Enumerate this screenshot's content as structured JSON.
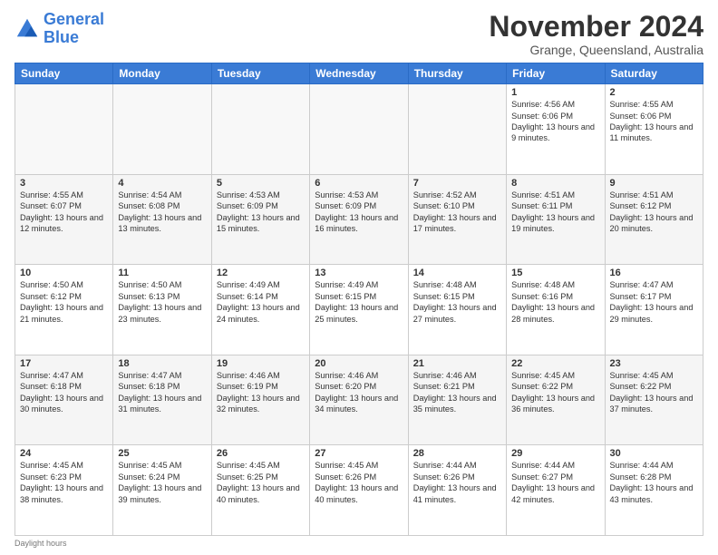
{
  "logo": {
    "line1": "General",
    "line2": "Blue"
  },
  "title": "November 2024",
  "subtitle": "Grange, Queensland, Australia",
  "days_of_week": [
    "Sunday",
    "Monday",
    "Tuesday",
    "Wednesday",
    "Thursday",
    "Friday",
    "Saturday"
  ],
  "footer": "Daylight hours",
  "weeks": [
    [
      {
        "day": "",
        "sunrise": "",
        "sunset": "",
        "daylight": ""
      },
      {
        "day": "",
        "sunrise": "",
        "sunset": "",
        "daylight": ""
      },
      {
        "day": "",
        "sunrise": "",
        "sunset": "",
        "daylight": ""
      },
      {
        "day": "",
        "sunrise": "",
        "sunset": "",
        "daylight": ""
      },
      {
        "day": "",
        "sunrise": "",
        "sunset": "",
        "daylight": ""
      },
      {
        "day": "1",
        "sunrise": "Sunrise: 4:56 AM",
        "sunset": "Sunset: 6:06 PM",
        "daylight": "Daylight: 13 hours and 9 minutes."
      },
      {
        "day": "2",
        "sunrise": "Sunrise: 4:55 AM",
        "sunset": "Sunset: 6:06 PM",
        "daylight": "Daylight: 13 hours and 11 minutes."
      }
    ],
    [
      {
        "day": "3",
        "sunrise": "Sunrise: 4:55 AM",
        "sunset": "Sunset: 6:07 PM",
        "daylight": "Daylight: 13 hours and 12 minutes."
      },
      {
        "day": "4",
        "sunrise": "Sunrise: 4:54 AM",
        "sunset": "Sunset: 6:08 PM",
        "daylight": "Daylight: 13 hours and 13 minutes."
      },
      {
        "day": "5",
        "sunrise": "Sunrise: 4:53 AM",
        "sunset": "Sunset: 6:09 PM",
        "daylight": "Daylight: 13 hours and 15 minutes."
      },
      {
        "day": "6",
        "sunrise": "Sunrise: 4:53 AM",
        "sunset": "Sunset: 6:09 PM",
        "daylight": "Daylight: 13 hours and 16 minutes."
      },
      {
        "day": "7",
        "sunrise": "Sunrise: 4:52 AM",
        "sunset": "Sunset: 6:10 PM",
        "daylight": "Daylight: 13 hours and 17 minutes."
      },
      {
        "day": "8",
        "sunrise": "Sunrise: 4:51 AM",
        "sunset": "Sunset: 6:11 PM",
        "daylight": "Daylight: 13 hours and 19 minutes."
      },
      {
        "day": "9",
        "sunrise": "Sunrise: 4:51 AM",
        "sunset": "Sunset: 6:12 PM",
        "daylight": "Daylight: 13 hours and 20 minutes."
      }
    ],
    [
      {
        "day": "10",
        "sunrise": "Sunrise: 4:50 AM",
        "sunset": "Sunset: 6:12 PM",
        "daylight": "Daylight: 13 hours and 21 minutes."
      },
      {
        "day": "11",
        "sunrise": "Sunrise: 4:50 AM",
        "sunset": "Sunset: 6:13 PM",
        "daylight": "Daylight: 13 hours and 23 minutes."
      },
      {
        "day": "12",
        "sunrise": "Sunrise: 4:49 AM",
        "sunset": "Sunset: 6:14 PM",
        "daylight": "Daylight: 13 hours and 24 minutes."
      },
      {
        "day": "13",
        "sunrise": "Sunrise: 4:49 AM",
        "sunset": "Sunset: 6:15 PM",
        "daylight": "Daylight: 13 hours and 25 minutes."
      },
      {
        "day": "14",
        "sunrise": "Sunrise: 4:48 AM",
        "sunset": "Sunset: 6:15 PM",
        "daylight": "Daylight: 13 hours and 27 minutes."
      },
      {
        "day": "15",
        "sunrise": "Sunrise: 4:48 AM",
        "sunset": "Sunset: 6:16 PM",
        "daylight": "Daylight: 13 hours and 28 minutes."
      },
      {
        "day": "16",
        "sunrise": "Sunrise: 4:47 AM",
        "sunset": "Sunset: 6:17 PM",
        "daylight": "Daylight: 13 hours and 29 minutes."
      }
    ],
    [
      {
        "day": "17",
        "sunrise": "Sunrise: 4:47 AM",
        "sunset": "Sunset: 6:18 PM",
        "daylight": "Daylight: 13 hours and 30 minutes."
      },
      {
        "day": "18",
        "sunrise": "Sunrise: 4:47 AM",
        "sunset": "Sunset: 6:18 PM",
        "daylight": "Daylight: 13 hours and 31 minutes."
      },
      {
        "day": "19",
        "sunrise": "Sunrise: 4:46 AM",
        "sunset": "Sunset: 6:19 PM",
        "daylight": "Daylight: 13 hours and 32 minutes."
      },
      {
        "day": "20",
        "sunrise": "Sunrise: 4:46 AM",
        "sunset": "Sunset: 6:20 PM",
        "daylight": "Daylight: 13 hours and 34 minutes."
      },
      {
        "day": "21",
        "sunrise": "Sunrise: 4:46 AM",
        "sunset": "Sunset: 6:21 PM",
        "daylight": "Daylight: 13 hours and 35 minutes."
      },
      {
        "day": "22",
        "sunrise": "Sunrise: 4:45 AM",
        "sunset": "Sunset: 6:22 PM",
        "daylight": "Daylight: 13 hours and 36 minutes."
      },
      {
        "day": "23",
        "sunrise": "Sunrise: 4:45 AM",
        "sunset": "Sunset: 6:22 PM",
        "daylight": "Daylight: 13 hours and 37 minutes."
      }
    ],
    [
      {
        "day": "24",
        "sunrise": "Sunrise: 4:45 AM",
        "sunset": "Sunset: 6:23 PM",
        "daylight": "Daylight: 13 hours and 38 minutes."
      },
      {
        "day": "25",
        "sunrise": "Sunrise: 4:45 AM",
        "sunset": "Sunset: 6:24 PM",
        "daylight": "Daylight: 13 hours and 39 minutes."
      },
      {
        "day": "26",
        "sunrise": "Sunrise: 4:45 AM",
        "sunset": "Sunset: 6:25 PM",
        "daylight": "Daylight: 13 hours and 40 minutes."
      },
      {
        "day": "27",
        "sunrise": "Sunrise: 4:45 AM",
        "sunset": "Sunset: 6:26 PM",
        "daylight": "Daylight: 13 hours and 40 minutes."
      },
      {
        "day": "28",
        "sunrise": "Sunrise: 4:44 AM",
        "sunset": "Sunset: 6:26 PM",
        "daylight": "Daylight: 13 hours and 41 minutes."
      },
      {
        "day": "29",
        "sunrise": "Sunrise: 4:44 AM",
        "sunset": "Sunset: 6:27 PM",
        "daylight": "Daylight: 13 hours and 42 minutes."
      },
      {
        "day": "30",
        "sunrise": "Sunrise: 4:44 AM",
        "sunset": "Sunset: 6:28 PM",
        "daylight": "Daylight: 13 hours and 43 minutes."
      }
    ]
  ]
}
